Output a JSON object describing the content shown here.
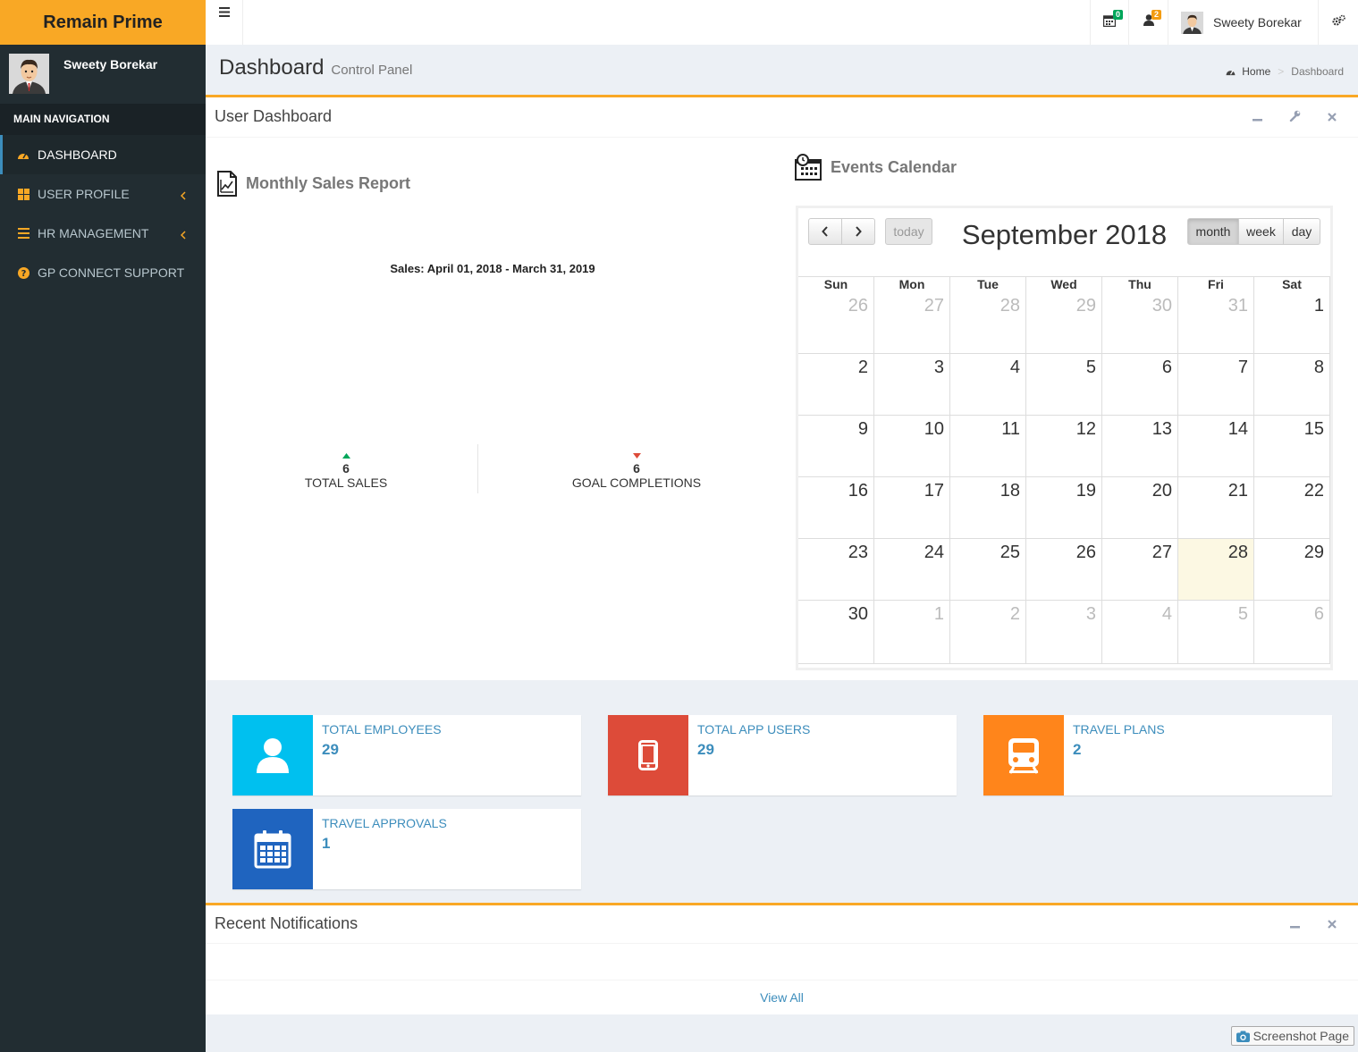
{
  "app": {
    "title": "Remain Prime"
  },
  "user": {
    "name": "Sweety  Borekar"
  },
  "sidebar": {
    "header": "MAIN NAVIGATION",
    "items": [
      {
        "label": "DASHBOARD"
      },
      {
        "label": "USER PROFILE"
      },
      {
        "label": "HR MANAGEMENT"
      },
      {
        "label": "GP CONNECT SUPPORT"
      }
    ]
  },
  "topbar": {
    "calendar_badge": "0",
    "user_badge": "2",
    "user_name": "Sweety  Borekar"
  },
  "header": {
    "title": "Dashboard",
    "subtitle": "Control Panel",
    "breadcrumb_home": "Home",
    "breadcrumb_current": "Dashboard"
  },
  "dashboard": {
    "title": "User Dashboard",
    "sales": {
      "title": "Monthly Sales Report",
      "range": "Sales: April 01, 2018 - March 31, 2019",
      "total_sales_value": "6",
      "total_sales_label": "TOTAL SALES",
      "goal_value": "6",
      "goal_label": "GOAL COMPLETIONS"
    },
    "calendar": {
      "title": "Events Calendar",
      "month_title": "September 2018",
      "today_label": "today",
      "views": {
        "month": "month",
        "week": "week",
        "day": "day"
      },
      "days_of_week": [
        "Sun",
        "Mon",
        "Tue",
        "Wed",
        "Thu",
        "Fri",
        "Sat"
      ],
      "weeks": [
        [
          "26",
          "27",
          "28",
          "29",
          "30",
          "31",
          "1"
        ],
        [
          "2",
          "3",
          "4",
          "5",
          "6",
          "7",
          "8"
        ],
        [
          "9",
          "10",
          "11",
          "12",
          "13",
          "14",
          "15"
        ],
        [
          "16",
          "17",
          "18",
          "19",
          "20",
          "21",
          "22"
        ],
        [
          "23",
          "24",
          "25",
          "26",
          "27",
          "28",
          "29"
        ],
        [
          "30",
          "1",
          "2",
          "3",
          "4",
          "5",
          "6"
        ]
      ]
    }
  },
  "stats": [
    {
      "label": "TOTAL EMPLOYEES",
      "value": "29",
      "color": "#00c0ef"
    },
    {
      "label": "TOTAL APP USERS",
      "value": "29",
      "color": "#dd4b39"
    },
    {
      "label": "TRAVEL PLANS",
      "value": "2",
      "color": "#ff851b"
    },
    {
      "label": "TRAVEL APPROVALS",
      "value": "1",
      "color": "#1f64bf"
    }
  ],
  "notifications": {
    "title": "Recent Notifications",
    "view_all": "View All"
  },
  "screenshot": {
    "label": "Screenshot Page"
  },
  "colors": {
    "brand": "#f9a825",
    "sidebar": "#222d32",
    "link": "#3c8dbc"
  }
}
